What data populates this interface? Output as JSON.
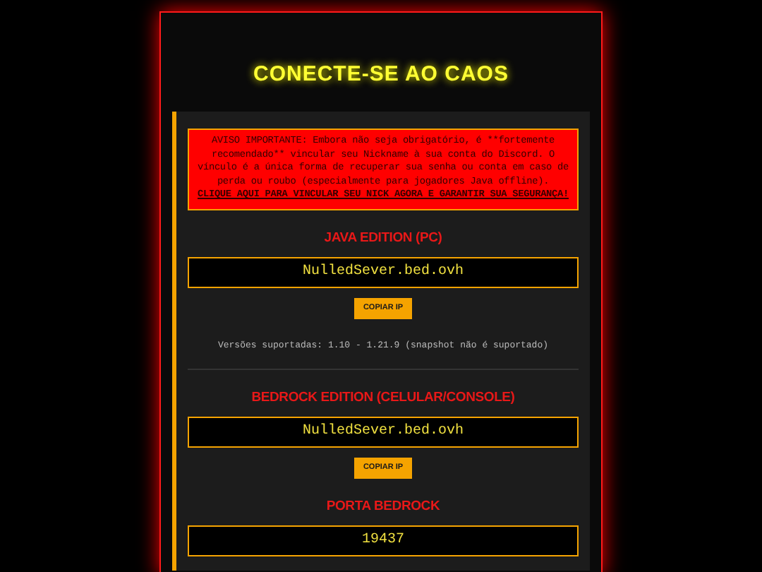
{
  "title": "CONECTE-SE AO CAOS",
  "notice": {
    "text": "AVISO IMPORTANTE: Embora não seja obrigatório, é **fortemente recomendado** vincular seu Nickname à sua conta do Discord. O vínculo é a única forma de recuperar sua senha ou conta em caso de perda ou roubo (especialmente para jogadores Java offline).",
    "link": "CLIQUE AQUI PARA VINCULAR SEU NICK AGORA E GARANTIR SUA SEGURANÇA!"
  },
  "sections": [
    {
      "heading": "JAVA EDITION (PC)",
      "address": "NulledSever.bed.ovh",
      "button": "COPIAR IP",
      "note": "Versões suportadas: 1.10 - 1.21.9 (snapshot não é suportado)",
      "divider": true
    },
    {
      "heading": "BEDROCK EDITION (CELULAR/CONSOLE)",
      "address": "NulledSever.bed.ovh",
      "button": "COPIAR IP",
      "divider": false
    },
    {
      "heading": "PORTA BEDROCK",
      "address": "19437",
      "divider": false
    }
  ]
}
